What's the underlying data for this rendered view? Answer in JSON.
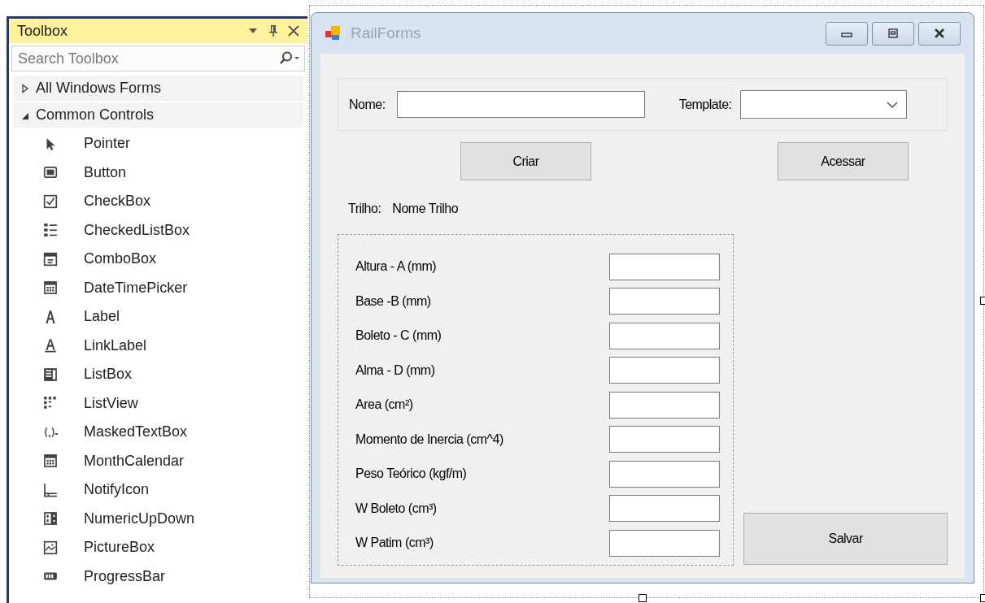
{
  "toolbox": {
    "title": "Toolbox",
    "search": {
      "placeholder": "Search Toolbox"
    },
    "groups": [
      {
        "label": "All Windows Forms",
        "expanded": false
      },
      {
        "label": "Common Controls",
        "expanded": true
      }
    ],
    "items": [
      "Pointer",
      "Button",
      "CheckBox",
      "CheckedListBox",
      "ComboBox",
      "DateTimePicker",
      "Label",
      "LinkLabel",
      "ListBox",
      "ListView",
      "MaskedTextBox",
      "MonthCalendar",
      "NotifyIcon",
      "NumericUpDown",
      "PictureBox",
      "ProgressBar"
    ]
  },
  "form": {
    "title": "RailForms",
    "name_label": "Nome:",
    "template_label": "Template:",
    "buttons": [
      "Criar",
      "Acessar"
    ],
    "rail_label": "Trilho:",
    "rail_value": "Nome Trilho",
    "fields": [
      "Altura - A (mm)",
      "Base -B (mm)",
      "Boleto - C (mm)",
      "Alma - D (mm)",
      "Area (cm²)",
      "Momento de Inercia (cm^4)",
      "Peso Teórico (kgf/m)",
      "W Boleto (cm³)",
      "W Patim (cm³)"
    ],
    "save_button": "Salvar"
  }
}
